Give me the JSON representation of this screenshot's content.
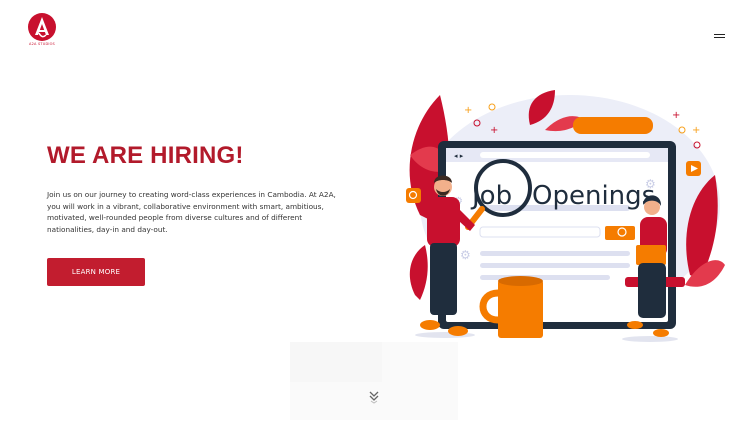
{
  "brand": {
    "caption": "A2A STUDIOS",
    "accent_color": "#c8102e"
  },
  "nav": {
    "menu_icon": "hamburger-icon"
  },
  "hero": {
    "headline": "WE ARE HIRING!",
    "body": "Join us on our journey to creating word-class experiences in Cambodia. At A2A, you will work in a vibrant, collaborative environment with smart, ambitious, motivated, well-rounded people from diverse cultures and of different nationalities, day-in and day-out.",
    "cta_label": "LEARN MORE",
    "cta_color": "#c21d2f"
  },
  "illustration": {
    "screen_text_1": "Job",
    "screen_text_2": "Openings"
  },
  "scroll": {
    "icon": "chevron-double-down-icon"
  }
}
